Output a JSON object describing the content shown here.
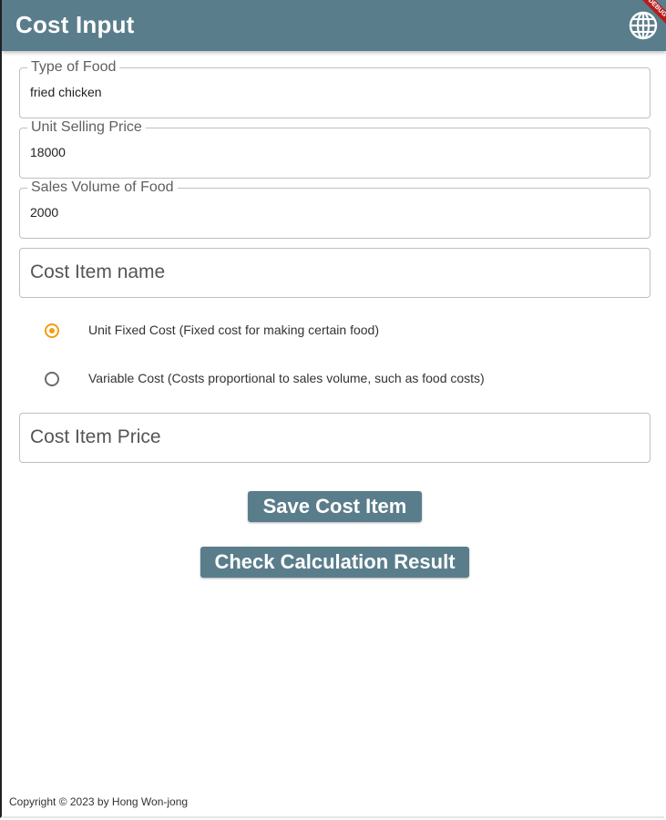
{
  "appbar": {
    "title": "Cost Input",
    "icon": "globe-icon",
    "banner": "DEBUG"
  },
  "fields": {
    "type_of_food": {
      "label": "Type of Food",
      "value": "fried chicken"
    },
    "unit_selling_price": {
      "label": "Unit Selling Price",
      "value": "18000"
    },
    "sales_volume": {
      "label": "Sales Volume of Food",
      "value": "2000"
    },
    "cost_item_name": {
      "placeholder": "Cost Item name"
    },
    "cost_item_price": {
      "placeholder": "Cost Item Price"
    }
  },
  "cost_type": {
    "selected": "unit_fixed",
    "options": [
      {
        "id": "unit_fixed",
        "label": "Unit Fixed Cost (Fixed cost for making certain food)"
      },
      {
        "id": "variable",
        "label": "Variable Cost (Costs proportional to sales volume, such as food costs)"
      }
    ]
  },
  "buttons": {
    "save": "Save Cost Item",
    "check": "Check Calculation Result"
  },
  "footer": {
    "copyright": "Copyright © 2023 by Hong Won-jong"
  },
  "colors": {
    "primary": "#5a7d8b",
    "radio_selected": "#f39c12"
  }
}
